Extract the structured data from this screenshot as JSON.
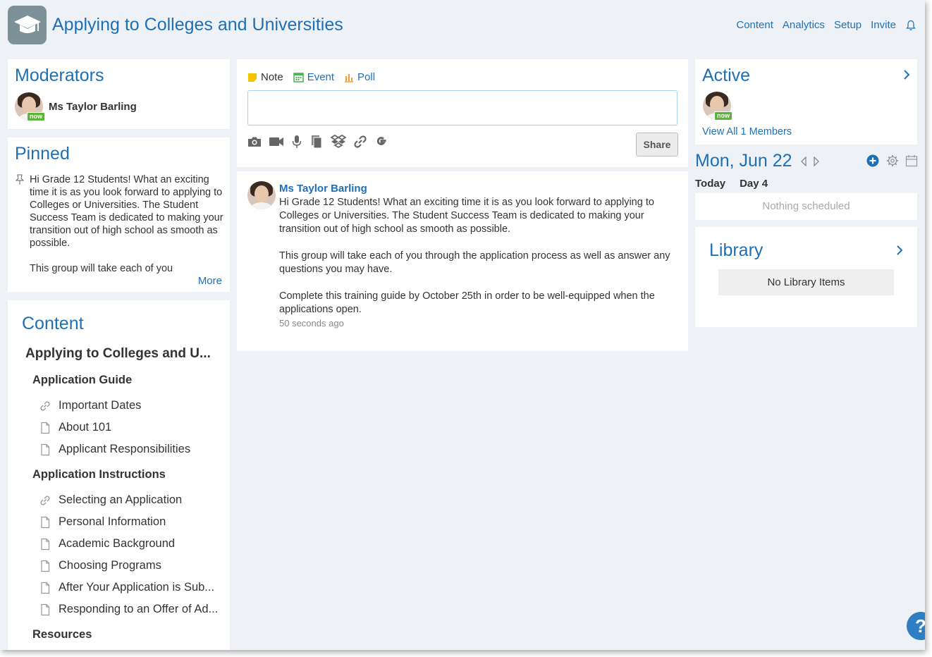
{
  "header": {
    "title": "Applying to Colleges and Universities",
    "nav": [
      "Content",
      "Analytics",
      "Setup",
      "Invite"
    ]
  },
  "moderators": {
    "title": "Moderators",
    "name": "Ms Taylor Barling",
    "status": "now"
  },
  "pinned": {
    "title": "Pinned",
    "text": "Hi Grade 12 Students! What an exciting time it is as you look forward to applying to Colleges or Universities. The Student Success Team is dedicated to making your transition out of high school as smooth as possible.\n\nThis group will take each of you",
    "more": "More"
  },
  "content": {
    "title": "Content",
    "root": "Applying to Colleges and U...",
    "sections": [
      {
        "label": "Application Guide",
        "items": [
          {
            "label": "Important Dates",
            "icon": "link-icon"
          },
          {
            "label": "About 101",
            "icon": "page-icon"
          },
          {
            "label": "Applicant Responsibilities",
            "icon": "page-icon"
          }
        ]
      },
      {
        "label": "Application Instructions",
        "items": [
          {
            "label": "Selecting an Application",
            "icon": "link-icon"
          },
          {
            "label": "Personal Information",
            "icon": "page-icon"
          },
          {
            "label": "Academic Background",
            "icon": "page-icon"
          },
          {
            "label": "Choosing Programs",
            "icon": "page-icon"
          },
          {
            "label": "After Your Application is Sub...",
            "icon": "page-icon"
          },
          {
            "label": "Responding to an Offer of Ad...",
            "icon": "page-icon"
          }
        ]
      },
      {
        "label": "Resources",
        "items": []
      }
    ]
  },
  "composer": {
    "types": [
      "Note",
      "Event",
      "Poll"
    ],
    "share_label": "Share",
    "colors": {
      "note": "#f5c400",
      "event": "#4caf50",
      "poll": "#f0a030"
    }
  },
  "post": {
    "author": "Ms Taylor Barling",
    "body": "Hi Grade 12 Students! What an exciting time it is as you look forward to applying to Colleges or Universities. The Student Success Team is dedicated to making your transition out of high school as smooth as possible.\n\nThis group will take each of you through the application process as well as answer any questions you may have.\n\nComplete this training guide by October 25th in order to be well-equipped when the applications open.",
    "time": "50 seconds ago"
  },
  "active": {
    "title": "Active",
    "status": "now",
    "view_all": "View All 1 Members"
  },
  "calendar": {
    "date": "Mon, Jun 22",
    "today": "Today",
    "day": "Day 4",
    "empty": "Nothing scheduled"
  },
  "library": {
    "title": "Library",
    "empty": "No Library Items"
  },
  "help": "?"
}
